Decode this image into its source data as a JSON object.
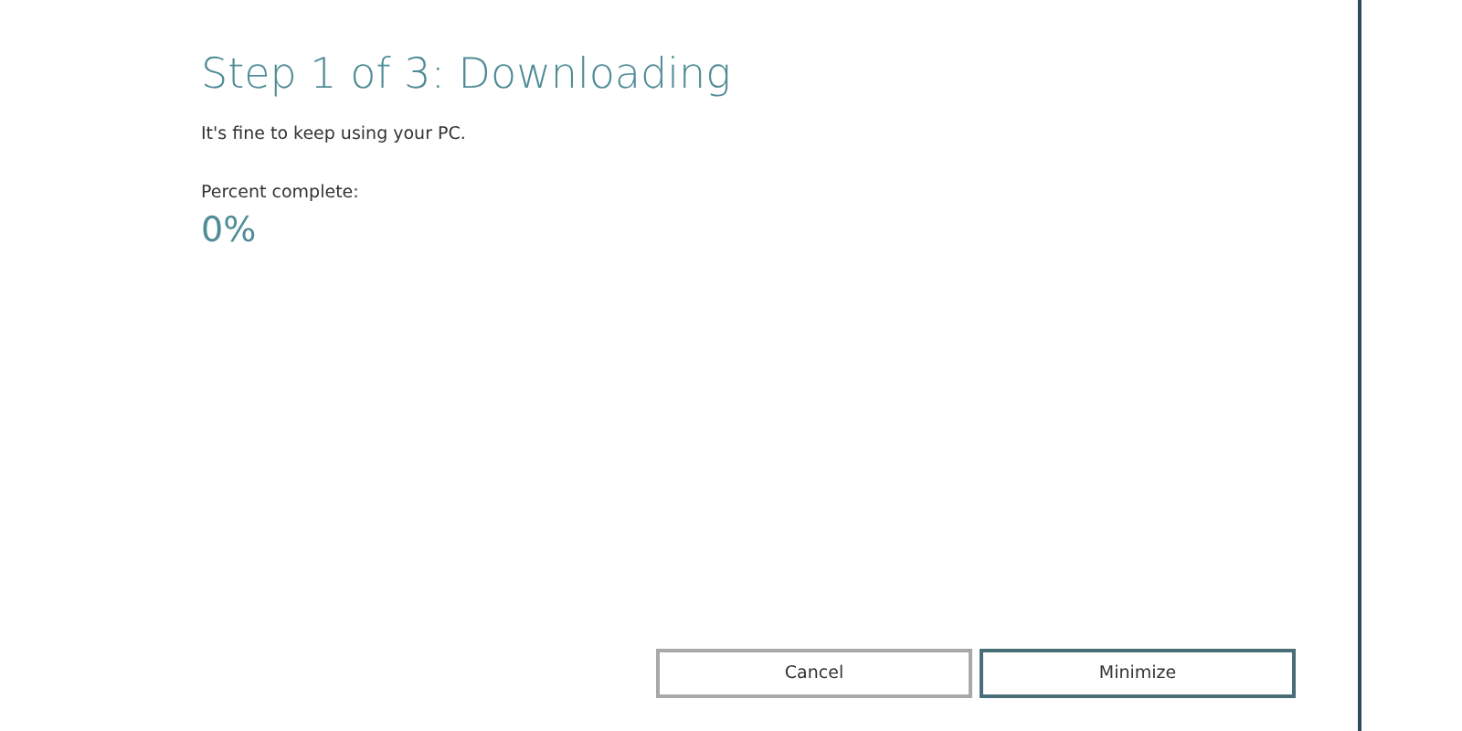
{
  "title": "Step 1 of 3: Downloading",
  "message": "It's fine to keep using your PC.",
  "progress": {
    "label": "Percent complete:",
    "value": "0%"
  },
  "buttons": [
    {
      "label": "Cancel",
      "default": false
    },
    {
      "label": "Minimize",
      "default": true
    }
  ]
}
